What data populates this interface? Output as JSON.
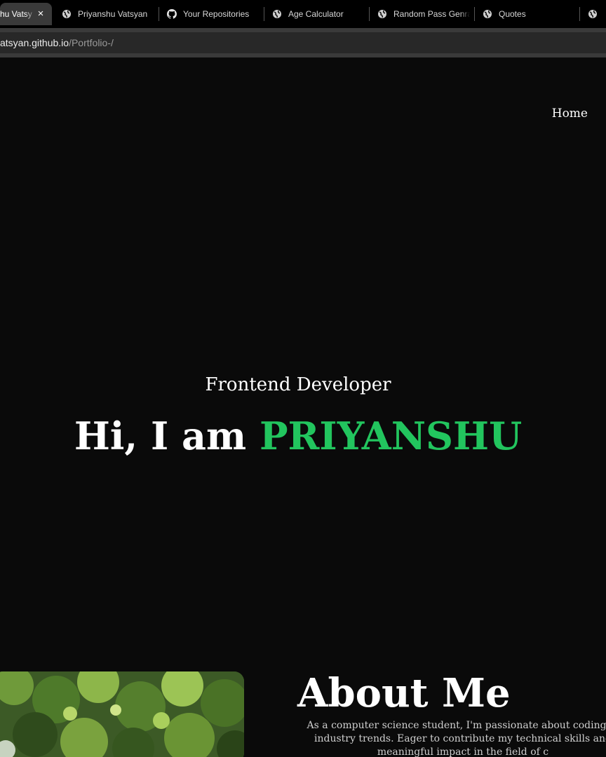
{
  "browser": {
    "tabs": [
      {
        "title": "hu Vatsy",
        "active": true,
        "icon": "globe-icon"
      },
      {
        "title": "Priyanshu Vatsyan",
        "active": false,
        "icon": "globe-icon"
      },
      {
        "title": "Your Repositories",
        "active": false,
        "icon": "github-icon"
      },
      {
        "title": "Age Calculator",
        "active": false,
        "icon": "globe-icon"
      },
      {
        "title": "Random Pass Genra",
        "active": false,
        "icon": "globe-icon"
      },
      {
        "title": "Quotes",
        "active": false,
        "icon": "globe-icon"
      },
      {
        "title": "",
        "active": false,
        "icon": "globe-icon"
      }
    ],
    "close_glyph": "×",
    "url_host": "atsyan.github.io",
    "url_path": "/Portfolio-/"
  },
  "nav": {
    "home_label": "Home"
  },
  "hero": {
    "subtitle": "Frontend Developer",
    "greeting": "Hi, I am ",
    "name": "PRIYANSHU",
    "name_color": "#22c55e"
  },
  "about": {
    "heading": "About Me",
    "lines": [
      "As a computer science student, I'm passionate about coding, p",
      "industry trends. Eager to contribute my technical skills and",
      "meaningful impact in the field of c"
    ]
  },
  "colors": {
    "page_background": "#0a0a0a",
    "accent": "#22c55e"
  }
}
